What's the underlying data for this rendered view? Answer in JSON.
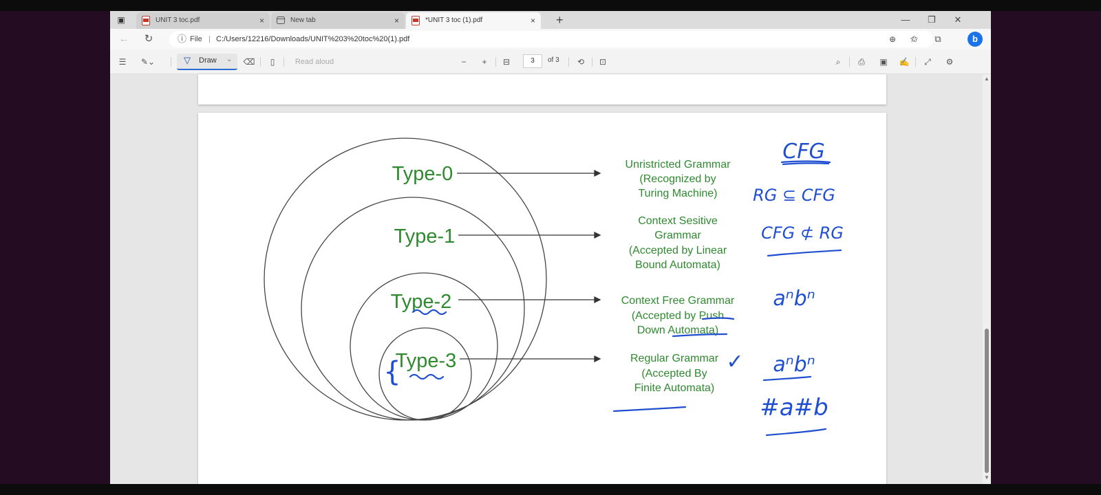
{
  "browser": {
    "tabs": [
      {
        "label": "UNIT 3 toc.pdf",
        "type": "pdf",
        "active": false
      },
      {
        "label": "New tab",
        "type": "newtab",
        "active": false
      },
      {
        "label": "*UNIT 3 toc (1).pdf",
        "type": "pdf",
        "active": true
      }
    ],
    "new_tab_symbol": "+",
    "close_symbol": "×",
    "address": {
      "scheme_label": "File",
      "url": "C:/Users/12216/Downloads/UNIT%203%20toc%20(1).pdf"
    }
  },
  "pdf_toolbar": {
    "draw_label": "Draw",
    "read_aloud_label": "Read aloud",
    "page_current": "3",
    "page_of": "of 3"
  },
  "diagram": {
    "types": [
      {
        "level": "Type-0",
        "desc": [
          "Unristricted Grammar",
          "(Recognized by",
          "Turing Machine)"
        ]
      },
      {
        "level": "Type-1",
        "desc": [
          "Context Sesitive",
          "Grammar",
          "(Accepted by Linear",
          "Bound Automata)"
        ]
      },
      {
        "level": "Type-2",
        "desc": [
          "Context Free Grammar",
          "(Accepted by Push",
          "Down Automata)"
        ]
      },
      {
        "level": "Type-3",
        "desc": [
          "Regular Grammar",
          "(Accepted By",
          "Finite Automata)"
        ]
      }
    ],
    "annotations": {
      "cfg": "CFG",
      "rg_subset": "RG ⊆ CFG",
      "cfg_not_subset": "CFG ⊄ RG",
      "anbn_1": "aⁿbⁿ",
      "anbn_2": "aⁿbⁿ",
      "na_nb": "#a#b",
      "check": "✓",
      "brace": "{"
    },
    "colors": {
      "green_text": "#2f8a2f",
      "ink_blue": "#1f4fd0"
    }
  }
}
